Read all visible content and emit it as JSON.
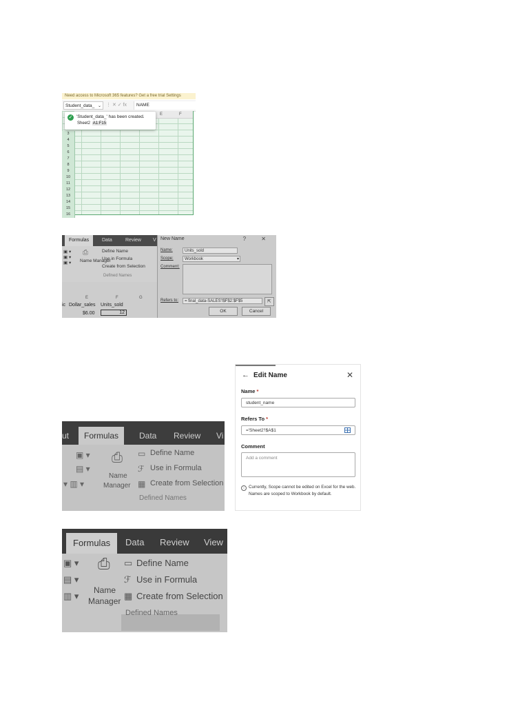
{
  "sheet_panel": {
    "message_bar": "Need access to Microsoft 365 features? Get a free trial Settings",
    "name_box": "Student_data_",
    "name_box_arrow": "⌄",
    "formula_icons": "⋮  ✕  ✓  fx",
    "formula_value": "NAME",
    "column_headers": [
      "E",
      "F"
    ],
    "row_numbers": [
      "3",
      "4",
      "5",
      "6",
      "7",
      "8",
      "9",
      "10",
      "11",
      "12",
      "13",
      "14",
      "15",
      "16"
    ],
    "toast": {
      "message": "'Student_data_' has been created.",
      "sheet": "Sheet2",
      "range": "A1:F15"
    }
  },
  "new_name_panel": {
    "tabs": [
      "Formulas",
      "Data",
      "Review",
      "V"
    ],
    "ribbon": {
      "define_name": "Define Name",
      "use_in_formula": "Use in Formula",
      "create_from_selection": "Create from Selection",
      "name_manager": "Name Manager",
      "group_label": "Defined Names"
    },
    "columns": [
      "E",
      "F",
      "G"
    ],
    "headers": [
      "ic",
      "Dollar_sales",
      "Units_sold"
    ],
    "row_values": [
      "$6.00",
      "12"
    ],
    "dialog": {
      "title": "New Name",
      "controls": "? ✕",
      "name_label": "Name:",
      "name_value": "Units_sold",
      "scope_label": "Scope:",
      "scope_value": "Workbook",
      "comment_label": "Comment:",
      "refers_to_label": "Refers to:",
      "refers_to_value": "= final_data-SALES'!$F$2:$F$5",
      "ok": "OK",
      "cancel": "Cancel"
    }
  },
  "ribbon_photo_1": {
    "tabs": [
      "ut",
      "Formulas",
      "Data",
      "Review",
      "Vi"
    ],
    "define_name": "Define Name",
    "use_in_formula": "Use in Formula",
    "create_from_selection": "Create from Selection",
    "name_manager_line1": "Name",
    "name_manager_line2": "Manager",
    "group_label": "Defined Names"
  },
  "ribbon_photo_2": {
    "tabs": [
      "Formulas",
      "Data",
      "Review",
      "View"
    ],
    "define_name": "Define Name",
    "use_in_formula": "Use in Formula",
    "create_from_selection": "Create from Selection",
    "name_manager_line1": "Name",
    "name_manager_line2": "Manager",
    "group_label": "Defined Names"
  },
  "edit_name_pane": {
    "back_icon": "←",
    "title": "Edit Name",
    "close_icon": "✕",
    "name_label": "Name",
    "name_value": "student_name",
    "refers_to_label": "Refers To",
    "refers_to_value": "='Sheet2'!$A$1",
    "comment_label": "Comment",
    "comment_placeholder": "Add a comment",
    "info_text": "Currently, Scope cannot be edited on Excel for the web. Names are scoped to Workbook by default.",
    "required_mark": "*"
  }
}
